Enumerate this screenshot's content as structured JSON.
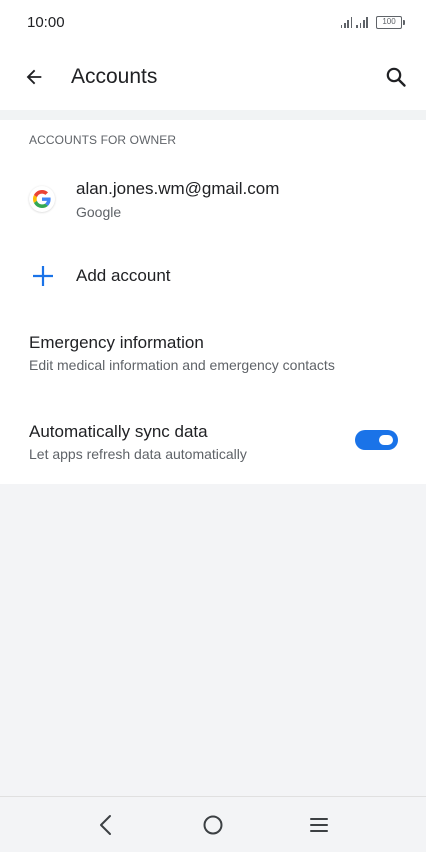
{
  "status_bar": {
    "time": "10:00",
    "battery": "100"
  },
  "app_bar": {
    "title": "Accounts",
    "back_icon": "arrow-back-icon",
    "search_icon": "search-icon"
  },
  "section": {
    "header": "ACCOUNTS FOR OWNER"
  },
  "account": {
    "email": "alan.jones.wm@gmail.com",
    "type": "Google",
    "icon": "google-logo-icon"
  },
  "add_account": {
    "label": "Add account",
    "icon": "plus-icon"
  },
  "emergency": {
    "title": "Emergency information",
    "subtitle": "Edit medical information and emergency contacts"
  },
  "sync": {
    "title": "Automatically sync data",
    "subtitle": "Let apps refresh data automatically",
    "enabled": true
  },
  "colors": {
    "accent": "#1a73e8",
    "background": "#f3f4f6"
  },
  "nav_bar": {
    "icons": [
      "nav-back-icon",
      "nav-home-icon",
      "nav-menu-icon"
    ]
  }
}
